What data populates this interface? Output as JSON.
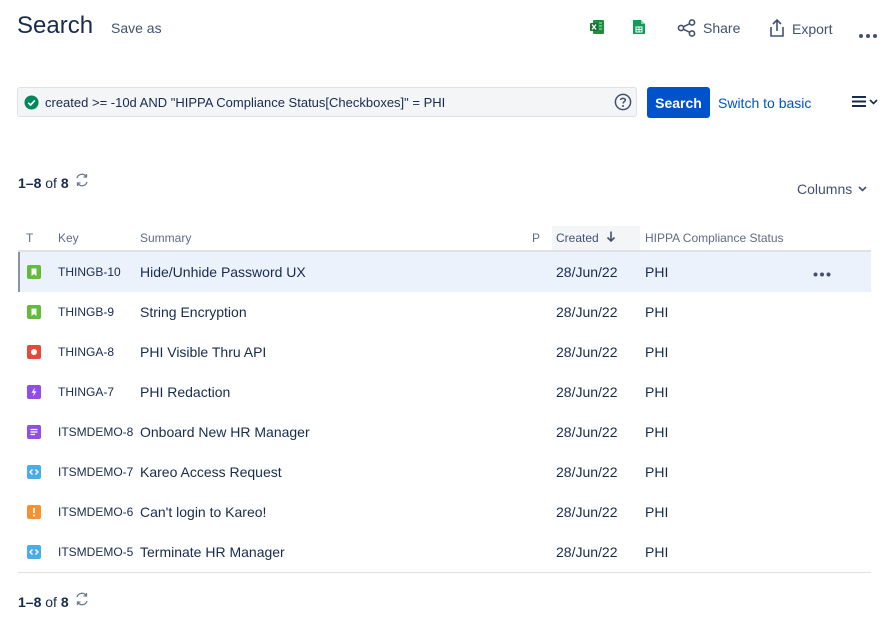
{
  "header": {
    "title": "Search",
    "save_as": "Save as",
    "share": "Share",
    "export": "Export"
  },
  "jql": {
    "query": "created >= -10d AND \"HIPPA Compliance Status[Checkboxes]\" = PHI",
    "search_label": "Search",
    "switch_basic": "Switch to basic"
  },
  "pager": {
    "range": "1–8",
    "of": "of",
    "total": "8"
  },
  "columns_label": "Columns",
  "columns": {
    "type": "T",
    "key": "Key",
    "summary": "Summary",
    "priority": "P",
    "created": "Created",
    "hippa": "HIPPA Compliance Status"
  },
  "issues": [
    {
      "type": "story",
      "color": "#63ba3c",
      "key": "THINGB-10",
      "summary": "Hide/Unhide Password UX",
      "created": "28/Jun/22",
      "status": "PHI"
    },
    {
      "type": "story",
      "color": "#63ba3c",
      "key": "THINGB-9",
      "summary": "String Encryption",
      "created": "28/Jun/22",
      "status": "PHI"
    },
    {
      "type": "bug",
      "color": "#e5493a",
      "key": "THINGA-8",
      "summary": "PHI Visible Thru API",
      "created": "28/Jun/22",
      "status": "PHI"
    },
    {
      "type": "epic",
      "color": "#904ee2",
      "key": "THINGA-7",
      "summary": "PHI Redaction",
      "created": "28/Jun/22",
      "status": "PHI"
    },
    {
      "type": "service-request",
      "color": "#904ee2",
      "key": "ITSMDEMO-8",
      "summary": "Onboard New HR Manager",
      "created": "28/Jun/22",
      "status": "PHI"
    },
    {
      "type": "change",
      "color": "#4bade8",
      "key": "ITSMDEMO-7",
      "summary": "Kareo Access Request",
      "created": "28/Jun/22",
      "status": "PHI"
    },
    {
      "type": "incident",
      "color": "#f79232",
      "key": "ITSMDEMO-6",
      "summary": "Can't login to Kareo!",
      "created": "28/Jun/22",
      "status": "PHI"
    },
    {
      "type": "change",
      "color": "#4bade8",
      "key": "ITSMDEMO-5",
      "summary": "Terminate HR Manager",
      "created": "28/Jun/22",
      "status": "PHI"
    }
  ]
}
